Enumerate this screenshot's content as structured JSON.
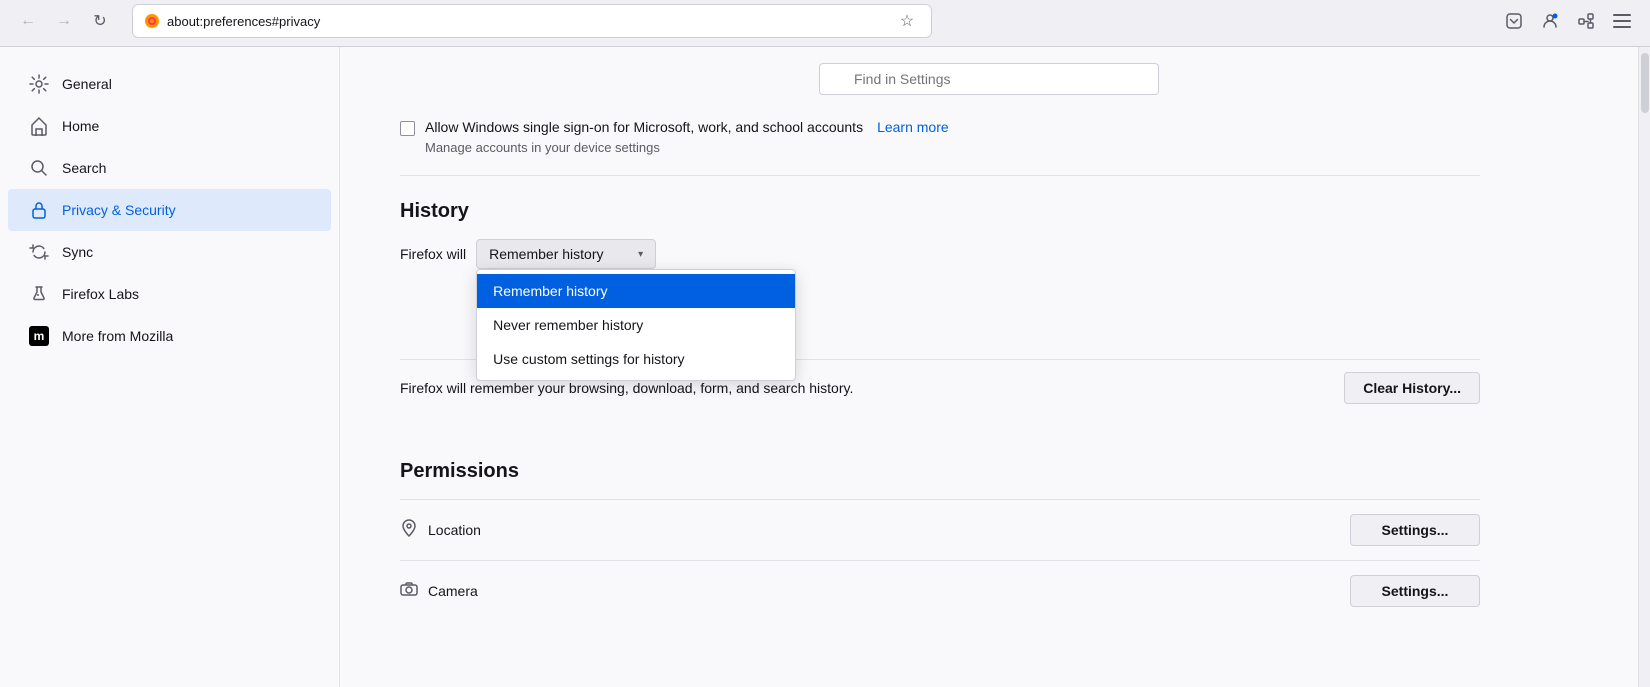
{
  "browser": {
    "back_button": "←",
    "forward_button": "→",
    "reload_button": "↻",
    "address": "about:preferences#privacy",
    "firefox_label": "Firefox",
    "star_icon": "☆",
    "pocket_icon": "📥",
    "profile_icon": "👤",
    "extensions_icon": "🧩",
    "menu_icon": "☰"
  },
  "find_settings": {
    "placeholder": "Find in Settings"
  },
  "sidebar": {
    "items": [
      {
        "id": "general",
        "label": "General",
        "icon": "⚙"
      },
      {
        "id": "home",
        "label": "Home",
        "icon": "⌂"
      },
      {
        "id": "search",
        "label": "Search",
        "icon": "🔍"
      },
      {
        "id": "privacy",
        "label": "Privacy & Security",
        "icon": "🔒"
      },
      {
        "id": "sync",
        "label": "Sync",
        "icon": "↻"
      },
      {
        "id": "firefox-labs",
        "label": "Firefox Labs",
        "icon": "⚗"
      },
      {
        "id": "more-mozilla",
        "label": "More from Mozilla",
        "icon": "m"
      }
    ]
  },
  "sso_section": {
    "checkbox_checked": false,
    "label": "Allow Windows single sign-on for Microsoft, work, and school accounts",
    "learn_more": "Learn more",
    "sub_text": "Manage accounts in your device settings"
  },
  "history": {
    "section_title": "History",
    "firefox_will_label": "Firefox will",
    "dropdown_selected": "Remember history",
    "dropdown_options": [
      {
        "id": "remember",
        "label": "Remember history",
        "selected": true
      },
      {
        "id": "never",
        "label": "Never remember history",
        "selected": false
      },
      {
        "id": "custom",
        "label": "Use custom settings for history",
        "selected": false
      }
    ],
    "description": "Firefox will remember your browsing, download, form, and search history.",
    "clear_history_btn": "Clear History..."
  },
  "permissions": {
    "section_title": "Permissions",
    "items": [
      {
        "id": "location",
        "label": "Location",
        "icon": "📍",
        "btn": "Settings..."
      },
      {
        "id": "camera",
        "label": "Camera",
        "icon": "📷",
        "btn": "Settings..."
      }
    ]
  }
}
